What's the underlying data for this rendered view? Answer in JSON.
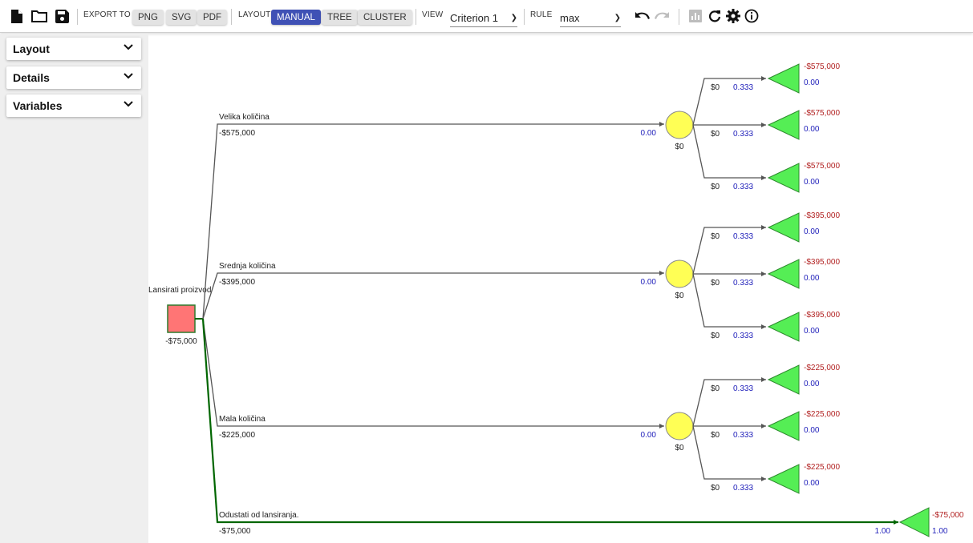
{
  "toolbar": {
    "export_label": "EXPORT TO",
    "export_buttons": [
      "PNG",
      "SVG",
      "PDF"
    ],
    "layout_label": "LAYOUT",
    "layout_buttons": [
      "MANUAL",
      "TREE",
      "CLUSTER"
    ],
    "layout_active": "MANUAL",
    "view_label": "VIEW",
    "view_value": "Criterion 1",
    "rule_label": "RULE",
    "rule_value": "max",
    "icons": [
      "new-file-icon",
      "open-folder-icon",
      "save-icon",
      "undo-icon",
      "redo-icon",
      "bar-chart-icon",
      "refresh-icon",
      "settings-icon",
      "info-icon"
    ]
  },
  "sidebar": {
    "panels": [
      "Layout",
      "Details",
      "Variables"
    ]
  },
  "tree": {
    "colors": {
      "decision_fill": "#ff7575",
      "chance_fill": "#ffff55",
      "terminal_fill": "#55ee55",
      "optimal_edge": "#006600",
      "payoff": "#b22222",
      "probability": "#2222bb"
    },
    "decision": {
      "label": "Lansirati proizvod",
      "value": "-$75,000"
    },
    "branches": [
      {
        "label": "Velika količina",
        "payoff": "-$575,000",
        "prob": "0.00",
        "chance_value": "$0",
        "outcomes": [
          {
            "payoff": "$0",
            "prob": "0.333",
            "aggregated": "-$575,000",
            "terminal_prob": "0.00"
          },
          {
            "payoff": "$0",
            "prob": "0.333",
            "aggregated": "-$575,000",
            "terminal_prob": "0.00"
          },
          {
            "payoff": "$0",
            "prob": "0.333",
            "aggregated": "-$575,000",
            "terminal_prob": "0.00"
          }
        ]
      },
      {
        "label": "Srednja količina",
        "payoff": "-$395,000",
        "prob": "0.00",
        "chance_value": "$0",
        "outcomes": [
          {
            "payoff": "$0",
            "prob": "0.333",
            "aggregated": "-$395,000",
            "terminal_prob": "0.00"
          },
          {
            "payoff": "$0",
            "prob": "0.333",
            "aggregated": "-$395,000",
            "terminal_prob": "0.00"
          },
          {
            "payoff": "$0",
            "prob": "0.333",
            "aggregated": "-$395,000",
            "terminal_prob": "0.00"
          }
        ]
      },
      {
        "label": "Mala količina",
        "payoff": "-$225,000",
        "prob": "0.00",
        "chance_value": "$0",
        "outcomes": [
          {
            "payoff": "$0",
            "prob": "0.333",
            "aggregated": "-$225,000",
            "terminal_prob": "0.00"
          },
          {
            "payoff": "$0",
            "prob": "0.333",
            "aggregated": "-$225,000",
            "terminal_prob": "0.00"
          },
          {
            "payoff": "$0",
            "prob": "0.333",
            "aggregated": "-$225,000",
            "terminal_prob": "0.00"
          }
        ]
      },
      {
        "label": "Odustati od lansiranja.",
        "payoff": "-$75,000",
        "prob": "1.00",
        "optimal": true,
        "terminal": {
          "aggregated": "-$75,000",
          "terminal_prob": "1.00"
        }
      }
    ]
  }
}
